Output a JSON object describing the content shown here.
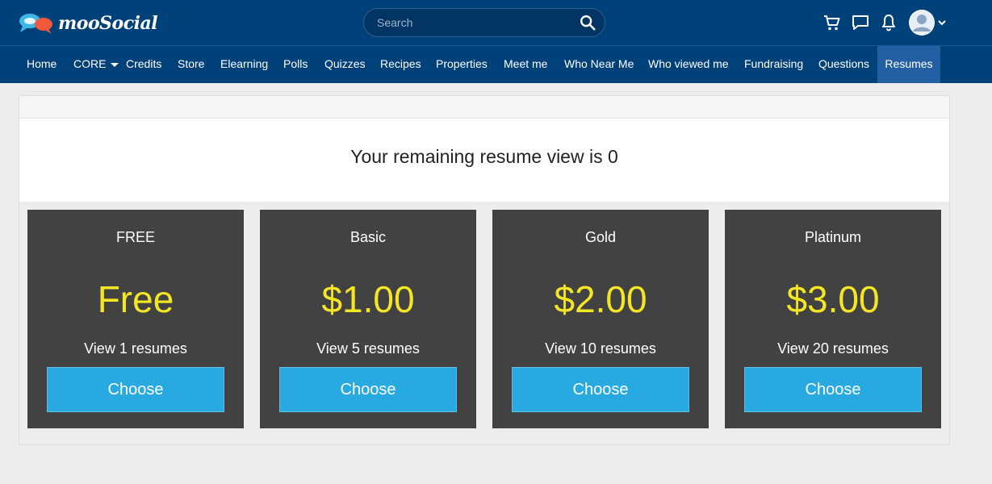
{
  "header": {
    "logo_text": "mooSocial",
    "search": {
      "placeholder": "Search",
      "value": ""
    },
    "icons": [
      "cart-icon",
      "chat-icon",
      "bell-icon",
      "avatar",
      "chevron-down-icon"
    ]
  },
  "nav": {
    "items": [
      {
        "label": "Home"
      },
      {
        "label": "CORE"
      },
      {
        "label": "Credits"
      },
      {
        "label": "Store"
      },
      {
        "label": "Elearning"
      },
      {
        "label": "Polls"
      },
      {
        "label": "Quizzes"
      },
      {
        "label": "Recipes"
      },
      {
        "label": "Properties"
      },
      {
        "label": "Meet me"
      },
      {
        "label": "Who Near Me"
      },
      {
        "label": "Who viewed me"
      },
      {
        "label": "Fundraising"
      },
      {
        "label": "Questions"
      },
      {
        "label": "Resumes"
      }
    ],
    "active": "Resumes"
  },
  "main": {
    "remaining_text": "Your remaining resume view is 0",
    "plans": [
      {
        "name": "FREE",
        "price": "Free",
        "description": "View 1 resumes",
        "button": "Choose"
      },
      {
        "name": "Basic",
        "price": "$1.00",
        "description": "View 5 resumes",
        "button": "Choose"
      },
      {
        "name": "Gold",
        "price": "$2.00",
        "description": "View 10 resumes",
        "button": "Choose"
      },
      {
        "name": "Platinum",
        "price": "$3.00",
        "description": "View 20 resumes",
        "button": "Choose"
      }
    ]
  },
  "colors": {
    "header_bg": "#01417a",
    "nav_active_bg": "#2260a3",
    "plan_bg": "#424242",
    "price_color": "#f5e625",
    "button_bg": "#28a9e0"
  }
}
